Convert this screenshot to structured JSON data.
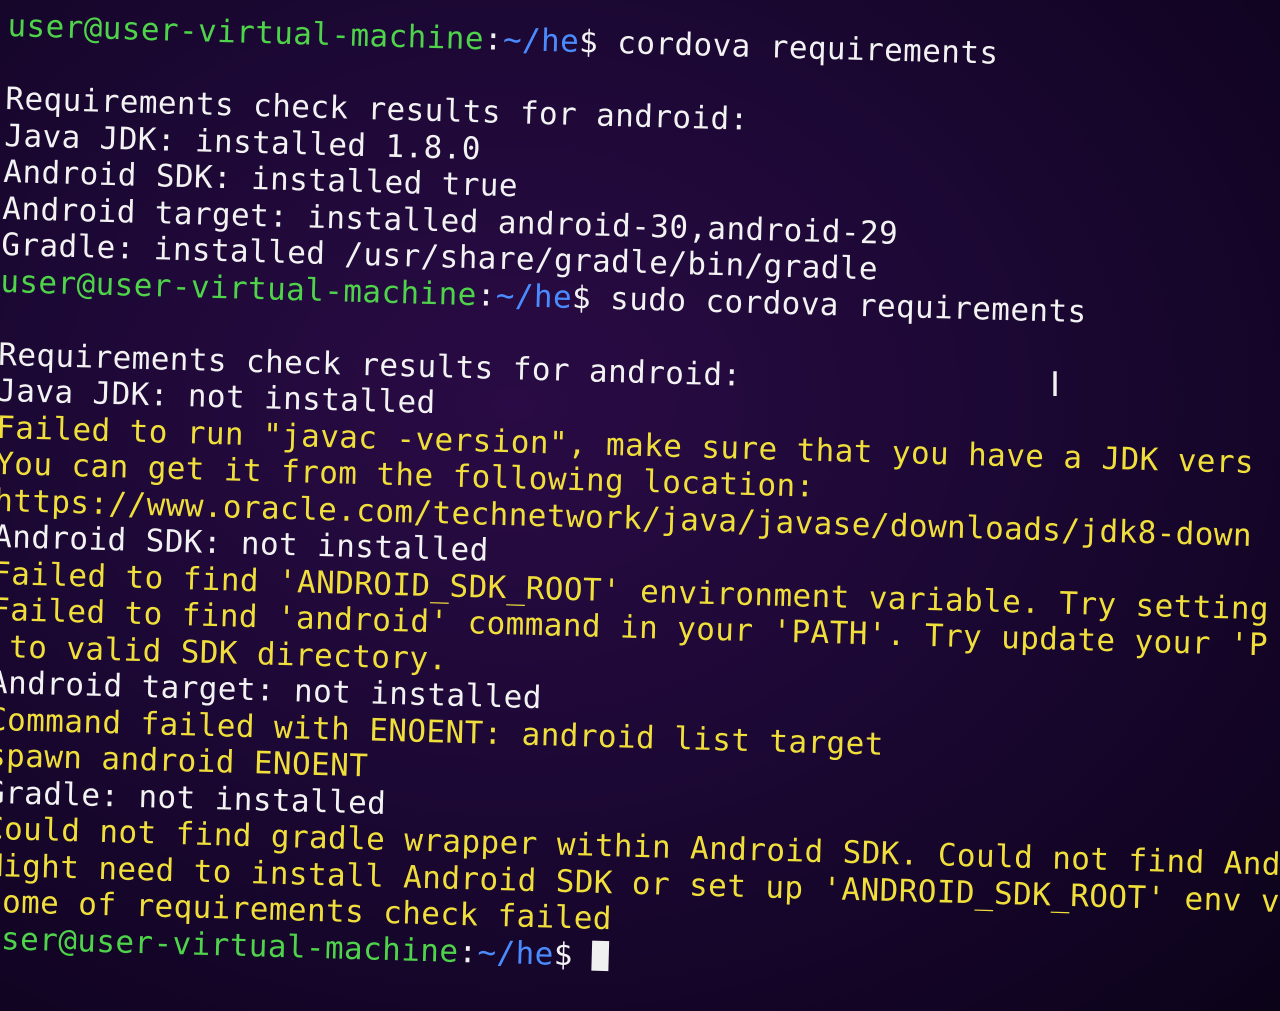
{
  "prompt": {
    "user_host": "user@user-virtual-machine",
    "separator": ":",
    "path": "~/he",
    "symbol": "$"
  },
  "lines": [
    {
      "type": "prompt",
      "command": " cordova requirements"
    },
    {
      "type": "blank"
    },
    {
      "type": "output",
      "color": "white",
      "text": "Requirements check results for android:"
    },
    {
      "type": "output",
      "color": "white",
      "text": "Java JDK: installed 1.8.0"
    },
    {
      "type": "output",
      "color": "white",
      "text": "Android SDK: installed true"
    },
    {
      "type": "output",
      "color": "white",
      "text": "Android target: installed android-30,android-29"
    },
    {
      "type": "output",
      "color": "white",
      "text": "Gradle: installed /usr/share/gradle/bin/gradle"
    },
    {
      "type": "prompt",
      "command": " sudo cordova requirements"
    },
    {
      "type": "blank"
    },
    {
      "type": "output",
      "color": "white",
      "text": "Requirements check results for android:"
    },
    {
      "type": "output",
      "color": "white",
      "text": "Java JDK: not installed"
    },
    {
      "type": "output",
      "color": "yellow",
      "text": "Failed to run \"javac -version\", make sure that you have a JDK vers"
    },
    {
      "type": "output",
      "color": "yellow",
      "text": "You can get it from the following location:"
    },
    {
      "type": "output",
      "color": "yellow",
      "text": "https://www.oracle.com/technetwork/java/javase/downloads/jdk8-down"
    },
    {
      "type": "output",
      "color": "white",
      "text": "Android SDK: not installed"
    },
    {
      "type": "output",
      "color": "yellow",
      "text": "Failed to find 'ANDROID_SDK_ROOT' environment variable. Try setting"
    },
    {
      "type": "output",
      "color": "yellow",
      "text": "Failed to find 'android' command in your 'PATH'. Try update your 'P"
    },
    {
      "type": "output",
      "color": "yellow",
      "text": " to valid SDK directory."
    },
    {
      "type": "output",
      "color": "white",
      "text": "Android target: not installed"
    },
    {
      "type": "output",
      "color": "yellow",
      "text": "Command failed with ENOENT: android list target"
    },
    {
      "type": "output",
      "color": "yellow",
      "text": "spawn android ENOENT"
    },
    {
      "type": "output",
      "color": "white",
      "text": "Gradle: not installed"
    },
    {
      "type": "output",
      "color": "yellow",
      "text": "Could not find gradle wrapper within Android SDK. Could not find Andr"
    },
    {
      "type": "output",
      "color": "yellow",
      "text": "Might need to install Android SDK or set up 'ANDROID_SDK_ROOT' env va"
    },
    {
      "type": "output",
      "color": "yellow",
      "text": "Some of requirements check failed"
    },
    {
      "type": "prompt",
      "command": " ",
      "cursor": true
    }
  ],
  "colors": {
    "user_host": "#4ed34a",
    "path": "#4a8cff",
    "text": "#f2f2f2",
    "warning": "#f0df3a",
    "background": "#1c0834"
  },
  "icons": {
    "mouse_pointer": "i-beam-cursor-icon"
  }
}
